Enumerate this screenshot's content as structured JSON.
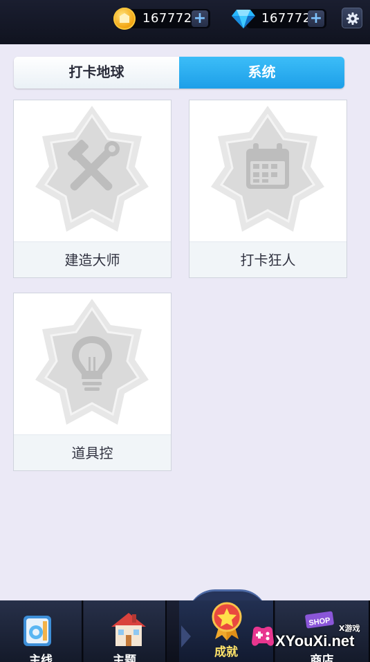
{
  "resources": {
    "coins": "167772",
    "gems": "167772",
    "plus_symbol": "+"
  },
  "tabs": {
    "left_label": "打卡地球",
    "right_label": "系统",
    "active": "系统"
  },
  "achievements": [
    {
      "name": "建造大师",
      "icon": "tools-icon",
      "locked": true
    },
    {
      "name": "打卡狂人",
      "icon": "calendar-icon",
      "locked": true
    },
    {
      "name": "道具控",
      "icon": "lightbulb-icon",
      "locked": true
    }
  ],
  "bottom_nav": {
    "items": [
      {
        "label": "主线",
        "icon": "main-line-icon"
      },
      {
        "label": "主题",
        "icon": "house-icon"
      },
      {
        "label": "成就",
        "icon": "star-medal-icon",
        "active": true
      },
      {
        "label": "商店",
        "icon": "shop-icon",
        "badge": "SHOP"
      }
    ]
  },
  "watermark": {
    "text": "XYouXi.net",
    "small": "X游戏"
  },
  "colors": {
    "background": "#ebe9f6",
    "active_tab": "#2aaef0",
    "topbar": "#141826",
    "locked_badge": "#d8d8d8"
  }
}
